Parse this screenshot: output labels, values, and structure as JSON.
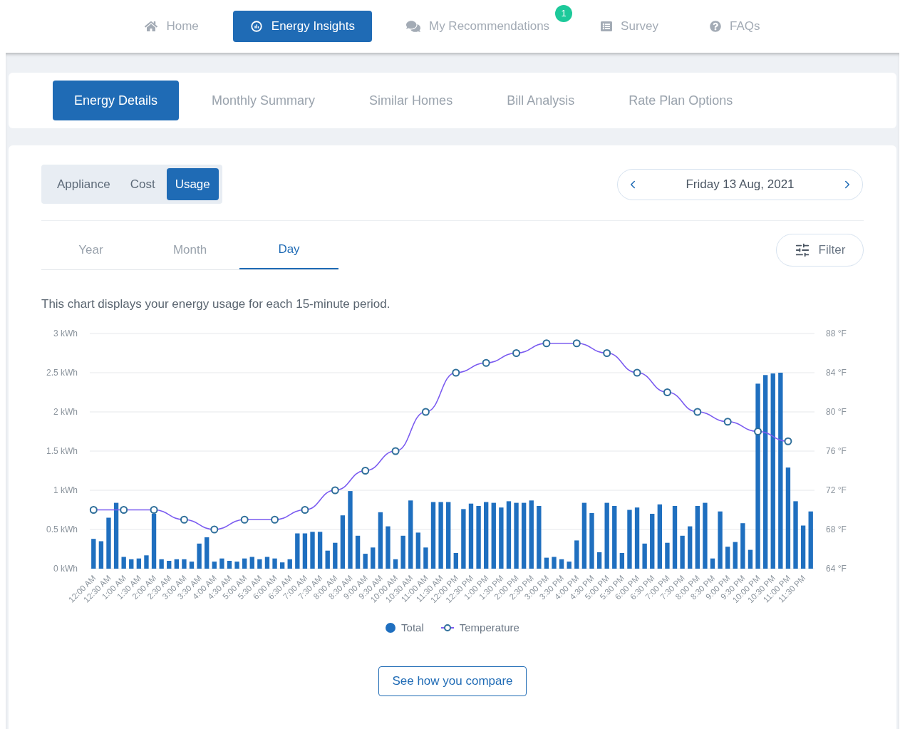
{
  "nav": {
    "items": [
      {
        "label": "Home",
        "selected": false
      },
      {
        "label": "Energy Insights",
        "selected": true
      },
      {
        "label": "My Recommendations",
        "selected": false,
        "badge": "1"
      },
      {
        "label": "Survey",
        "selected": false
      },
      {
        "label": "FAQs",
        "selected": false
      }
    ]
  },
  "sub_tabs": [
    {
      "label": "Energy Details",
      "selected": true
    },
    {
      "label": "Monthly Summary",
      "selected": false
    },
    {
      "label": "Similar Homes",
      "selected": false
    },
    {
      "label": "Bill Analysis",
      "selected": false
    },
    {
      "label": "Rate Plan Options",
      "selected": false
    }
  ],
  "view_toggle": [
    {
      "label": "Appliance",
      "selected": false
    },
    {
      "label": "Cost",
      "selected": false
    },
    {
      "label": "Usage",
      "selected": true
    }
  ],
  "date_nav": {
    "label": "Friday 13 Aug, 2021"
  },
  "period_tabs": [
    {
      "label": "Year",
      "selected": false
    },
    {
      "label": "Month",
      "selected": false
    },
    {
      "label": "Day",
      "selected": true
    }
  ],
  "filter_button": "Filter",
  "description": "This chart displays your energy usage for each 15-minute period.",
  "chart_data": {
    "type": "bar",
    "grid": true,
    "xlim": [
      -0.125,
      23.875
    ],
    "ylim": [
      0,
      3
    ],
    "y2lim": [
      64,
      88
    ],
    "yticks": [
      {
        "value": 0,
        "label": "0 kWh"
      },
      {
        "value": 0.5,
        "label": "0.5 kWh"
      },
      {
        "value": 1,
        "label": "1 kWh"
      },
      {
        "value": 1.5,
        "label": "1.5 kWh"
      },
      {
        "value": 2,
        "label": "2 kWh"
      },
      {
        "value": 2.5,
        "label": "2.5 kWh"
      },
      {
        "value": 3,
        "label": "3 kWh"
      }
    ],
    "y2ticks": [
      {
        "value": 64,
        "label": "64 °F"
      },
      {
        "value": 68,
        "label": "68 °F"
      },
      {
        "value": 72,
        "label": "72 °F"
      },
      {
        "value": 76,
        "label": "76 °F"
      },
      {
        "value": 80,
        "label": "80 °F"
      },
      {
        "value": 84,
        "label": "84 °F"
      },
      {
        "value": 88,
        "label": "88 °F"
      }
    ],
    "xticks": [
      {
        "value": 0,
        "label": "12:00 AM"
      },
      {
        "value": 0.5,
        "label": "12:30 AM"
      },
      {
        "value": 1,
        "label": "1:00 AM"
      },
      {
        "value": 1.5,
        "label": "1:30 AM"
      },
      {
        "value": 2,
        "label": "2:00 AM"
      },
      {
        "value": 2.5,
        "label": "2:30 AM"
      },
      {
        "value": 3,
        "label": "3:00 AM"
      },
      {
        "value": 3.5,
        "label": "3:30 AM"
      },
      {
        "value": 4,
        "label": "4:00 AM"
      },
      {
        "value": 4.5,
        "label": "4:30 AM"
      },
      {
        "value": 5,
        "label": "5:00 AM"
      },
      {
        "value": 5.5,
        "label": "5:30 AM"
      },
      {
        "value": 6,
        "label": "6:00 AM"
      },
      {
        "value": 6.5,
        "label": "6:30 AM"
      },
      {
        "value": 7,
        "label": "7:00 AM"
      },
      {
        "value": 7.5,
        "label": "7:30 AM"
      },
      {
        "value": 8,
        "label": "8:00 AM"
      },
      {
        "value": 8.5,
        "label": "8:30 AM"
      },
      {
        "value": 9,
        "label": "9:00 AM"
      },
      {
        "value": 9.5,
        "label": "9:30 AM"
      },
      {
        "value": 10,
        "label": "10:00 AM"
      },
      {
        "value": 10.5,
        "label": "10:30 AM"
      },
      {
        "value": 11,
        "label": "11:00 AM"
      },
      {
        "value": 11.5,
        "label": "11:30 AM"
      },
      {
        "value": 12,
        "label": "12:00 PM"
      },
      {
        "value": 12.5,
        "label": "12:30 PM"
      },
      {
        "value": 13,
        "label": "1:00 PM"
      },
      {
        "value": 13.5,
        "label": "1:30 PM"
      },
      {
        "value": 14,
        "label": "2:00 PM"
      },
      {
        "value": 14.5,
        "label": "2:30 PM"
      },
      {
        "value": 15,
        "label": "3:00 PM"
      },
      {
        "value": 15.5,
        "label": "3:30 PM"
      },
      {
        "value": 16,
        "label": "4:00 PM"
      },
      {
        "value": 16.5,
        "label": "4:30 PM"
      },
      {
        "value": 17,
        "label": "5:00 PM"
      },
      {
        "value": 17.5,
        "label": "5:30 PM"
      },
      {
        "value": 18,
        "label": "6:00 PM"
      },
      {
        "value": 18.5,
        "label": "6:30 PM"
      },
      {
        "value": 19,
        "label": "7:00 PM"
      },
      {
        "value": 19.5,
        "label": "7:30 PM"
      },
      {
        "value": 20,
        "label": "8:00 PM"
      },
      {
        "value": 20.5,
        "label": "8:30 PM"
      },
      {
        "value": 21,
        "label": "9:00 PM"
      },
      {
        "value": 21.5,
        "label": "9:30 PM"
      },
      {
        "value": 22,
        "label": "10:00 PM"
      },
      {
        "value": 22.5,
        "label": "10:30 PM"
      },
      {
        "value": 23,
        "label": "11:00 PM"
      },
      {
        "value": 23.5,
        "label": "11:30 PM"
      }
    ],
    "x": [
      0,
      0.25,
      0.5,
      0.75,
      1,
      1.25,
      1.5,
      1.75,
      2,
      2.25,
      2.5,
      2.75,
      3,
      3.25,
      3.5,
      3.75,
      4,
      4.25,
      4.5,
      4.75,
      5,
      5.25,
      5.5,
      5.75,
      6,
      6.25,
      6.5,
      6.75,
      7,
      7.25,
      7.5,
      7.75,
      8,
      8.25,
      8.5,
      8.75,
      9,
      9.25,
      9.5,
      9.75,
      10,
      10.25,
      10.5,
      10.75,
      11,
      11.25,
      11.5,
      11.75,
      12,
      12.25,
      12.5,
      12.75,
      13,
      13.25,
      13.5,
      13.75,
      14,
      14.25,
      14.5,
      14.75,
      15,
      15.25,
      15.5,
      15.75,
      16,
      16.25,
      16.5,
      16.75,
      17,
      17.25,
      17.5,
      17.75,
      18,
      18.25,
      18.5,
      18.75,
      19,
      19.25,
      19.5,
      19.75,
      20,
      20.25,
      20.5,
      20.75,
      21,
      21.25,
      21.5,
      21.75,
      22,
      22.25,
      22.5,
      22.75,
      23,
      23.25,
      23.5,
      23.75
    ],
    "series": [
      {
        "name": "Total",
        "color": "#1f6fbf",
        "values": [
          0.38,
          0.35,
          0.65,
          0.84,
          0.15,
          0.12,
          0.13,
          0.17,
          0.7,
          0.12,
          0.1,
          0.12,
          0.12,
          0.09,
          0.32,
          0.4,
          0.09,
          0.13,
          0.1,
          0.09,
          0.13,
          0.15,
          0.12,
          0.15,
          0.13,
          0.08,
          0.12,
          0.45,
          0.45,
          0.47,
          0.47,
          0.23,
          0.33,
          0.68,
          0.99,
          0.42,
          0.19,
          0.27,
          0.72,
          0.54,
          0.12,
          0.42,
          0.87,
          0.46,
          0.27,
          0.85,
          0.85,
          0.85,
          0.2,
          0.76,
          0.83,
          0.8,
          0.85,
          0.84,
          0.78,
          0.86,
          0.84,
          0.84,
          0.87,
          0.8,
          0.14,
          0.15,
          0.12,
          0.09,
          0.36,
          0.84,
          0.71,
          0.21,
          0.84,
          0.8,
          0.2,
          0.75,
          0.78,
          0.32,
          0.7,
          0.82,
          0.33,
          0.8,
          0.42,
          0.54,
          0.8,
          0.84,
          0.13,
          0.73,
          0.28,
          0.34,
          0.58,
          0.24,
          2.36,
          2.47,
          2.49,
          2.5,
          1.29,
          0.86,
          0.55,
          0.73
        ]
      },
      {
        "name": "Temperature",
        "color": "#7b5cf0",
        "type": "line",
        "axis": "y2",
        "marker": "circle",
        "values": [
          70,
          null,
          null,
          null,
          70,
          null,
          null,
          null,
          70,
          null,
          null,
          null,
          69,
          null,
          null,
          null,
          68,
          null,
          null,
          null,
          69,
          null,
          null,
          null,
          69,
          null,
          null,
          null,
          70,
          null,
          null,
          null,
          72,
          null,
          null,
          null,
          74,
          null,
          null,
          null,
          76,
          null,
          null,
          null,
          80,
          null,
          null,
          null,
          84,
          null,
          null,
          null,
          85,
          null,
          null,
          null,
          86,
          null,
          null,
          null,
          87,
          null,
          null,
          null,
          87,
          null,
          null,
          null,
          86,
          null,
          null,
          null,
          84,
          null,
          null,
          null,
          82,
          null,
          null,
          null,
          80,
          null,
          null,
          null,
          79,
          null,
          null,
          null,
          78,
          null,
          null,
          null,
          77,
          null,
          null,
          null
        ]
      }
    ]
  },
  "compare_button": "See how you compare"
}
